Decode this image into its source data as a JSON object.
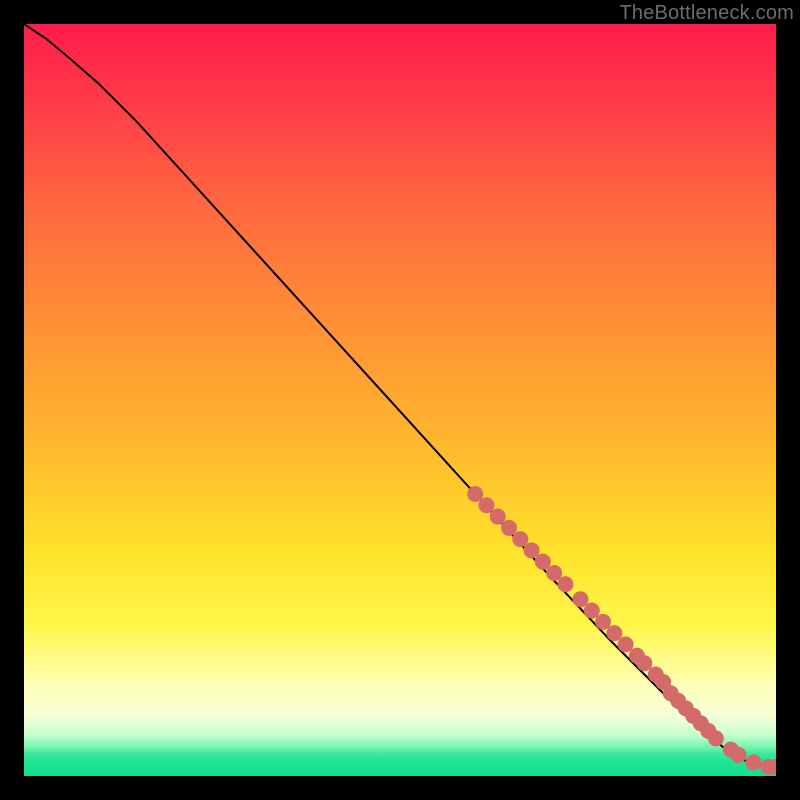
{
  "watermark": "TheBottleneck.com",
  "chart_data": {
    "type": "line",
    "title": "",
    "xlabel": "",
    "ylabel": "",
    "xlim": [
      0,
      100
    ],
    "ylim": [
      0,
      100
    ],
    "grid": false,
    "legend": false,
    "background_gradient": {
      "direction": "vertical",
      "stops": [
        {
          "pos": 0.0,
          "color": "#ff1c4a"
        },
        {
          "pos": 0.55,
          "color": "#ffb52e"
        },
        {
          "pos": 0.8,
          "color": "#fff64a"
        },
        {
          "pos": 0.92,
          "color": "#f6ffd6"
        },
        {
          "pos": 0.97,
          "color": "#3fe99c"
        },
        {
          "pos": 1.0,
          "color": "#17de8f"
        }
      ]
    },
    "series": [
      {
        "name": "curve",
        "type": "line",
        "color": "#000000",
        "x": [
          0,
          3,
          6,
          10,
          15,
          20,
          30,
          40,
          50,
          60,
          70,
          78,
          84,
          88,
          91,
          93,
          95,
          97,
          99,
          100
        ],
        "y": [
          100,
          98,
          95.5,
          92,
          87,
          81.5,
          70.5,
          59.5,
          48.5,
          37.5,
          26.5,
          18,
          12,
          8,
          5.5,
          3.8,
          2.5,
          1.5,
          1.2,
          1.2
        ]
      },
      {
        "name": "points-upper",
        "type": "scatter",
        "color": "#d46a6a",
        "marker_size": 8,
        "x": [
          60,
          61.5,
          63,
          64.5,
          66,
          67.5,
          69,
          70.5,
          72,
          74,
          75.5,
          77,
          78.5,
          80,
          81.5,
          82.5,
          84,
          85,
          86
        ],
        "y": [
          37.5,
          36,
          34.5,
          33,
          31.5,
          30,
          28.5,
          27,
          25.5,
          23.5,
          22,
          20.5,
          19,
          17.5,
          16,
          15,
          13.5,
          12.5,
          11
        ]
      },
      {
        "name": "points-lower",
        "type": "scatter",
        "color": "#d46a6a",
        "marker_size": 8,
        "x": [
          87,
          88,
          89,
          90,
          91,
          92,
          94,
          95,
          97,
          99,
          100
        ],
        "y": [
          10,
          9,
          8,
          7,
          6,
          5,
          3.5,
          2.8,
          1.8,
          1.2,
          1.2
        ]
      }
    ]
  }
}
